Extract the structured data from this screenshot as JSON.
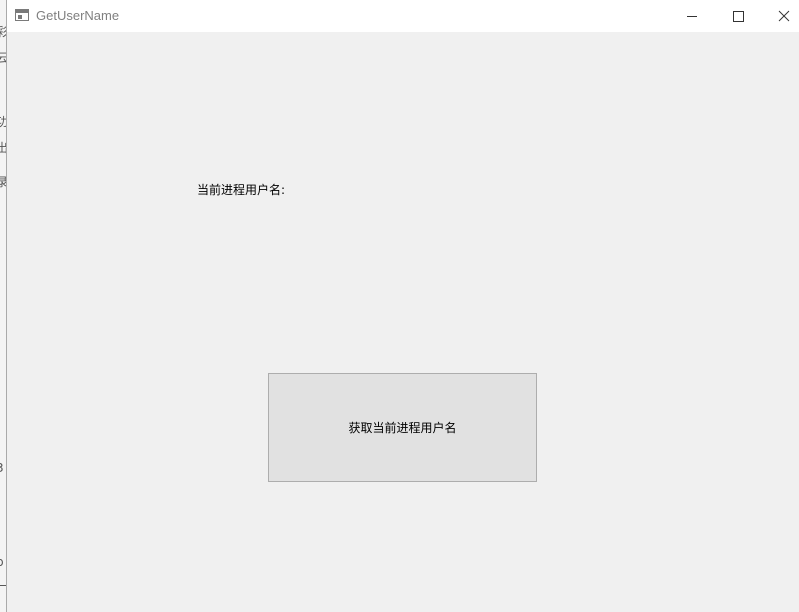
{
  "window": {
    "title": "GetUserName",
    "controls": {
      "minimize": "minimize-icon",
      "maximize": "maximize-icon",
      "close": "close-icon"
    }
  },
  "main": {
    "username_label": "当前进程用户名:",
    "get_button_label": "获取当前进程用户名"
  }
}
